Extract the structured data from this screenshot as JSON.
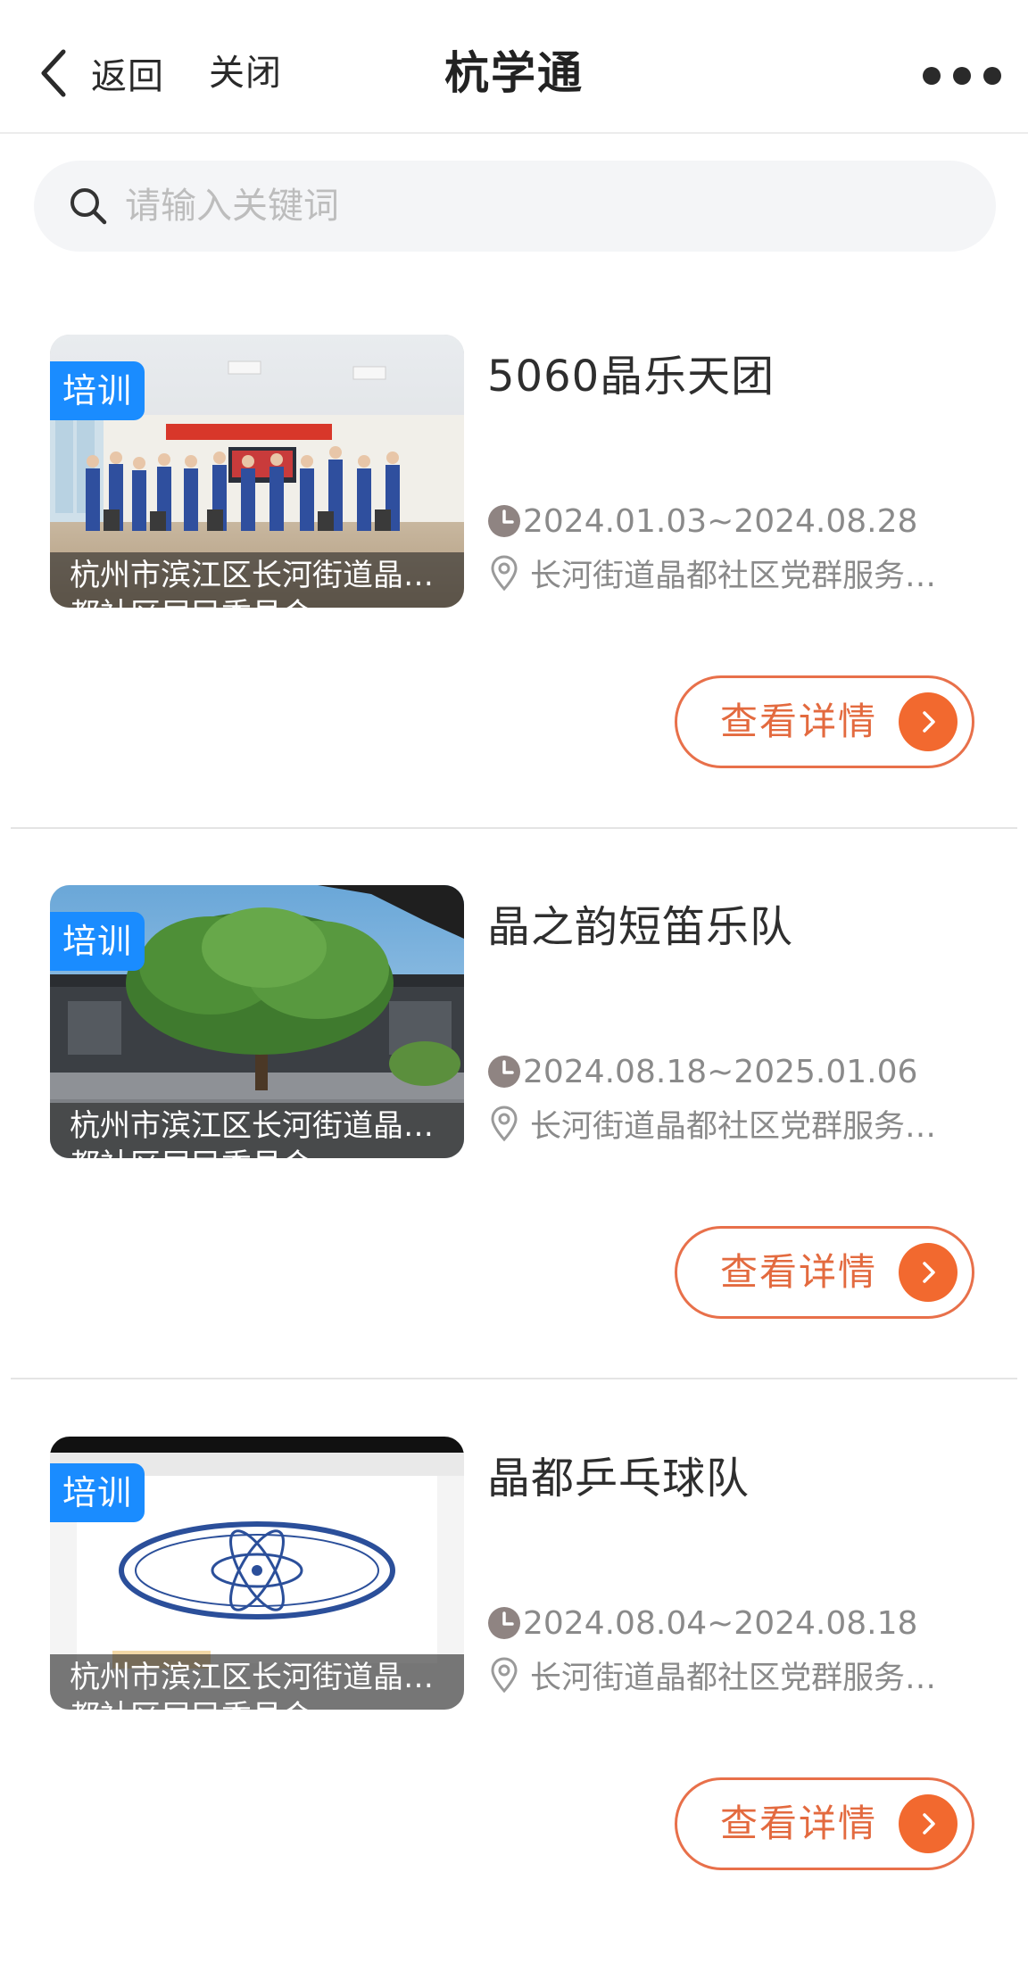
{
  "header": {
    "back_label": "返回",
    "close_label": "关闭",
    "title": "杭学通",
    "back_icon": "chevron-left-icon",
    "more_icon": "more-dots-icon"
  },
  "search": {
    "placeholder": "请输入关键词",
    "icon": "search-icon"
  },
  "colors": {
    "accent": "#f2692f",
    "tag": "#1a8cff",
    "title_text": "#2e2e2e",
    "secondary_text": "#8a8a8a",
    "divider": "#e4e4e4"
  },
  "items": [
    {
      "tag": "培训",
      "title": "5060晶乐天团",
      "date_range": "2024.01.03~2024.08.28",
      "location": "长河街道晶都社区党群服务…",
      "caption_line1": "杭州市滨江区长河街道晶都社区居民委员会",
      "caption_line2": "都社区居民委员会",
      "button_label": "查看详情"
    },
    {
      "tag": "培训",
      "title": "晶之韵短笛乐队",
      "date_range": "2024.08.18~2025.01.06",
      "location": "长河街道晶都社区党群服务…",
      "caption_line1": "杭州市滨江区长河街道晶都社区居民委员会",
      "caption_line2": "都社区居民委员会",
      "button_label": "查看详情"
    },
    {
      "tag": "培训",
      "title": "晶都乒乓球队",
      "date_range": "2024.08.04~2024.08.18",
      "location": "长河街道晶都社区党群服务…",
      "caption_line1": "杭州市滨江区长河街道晶都社区居民委员会",
      "caption_line2": "都社区居民委员会",
      "button_label": "查看详情"
    }
  ]
}
